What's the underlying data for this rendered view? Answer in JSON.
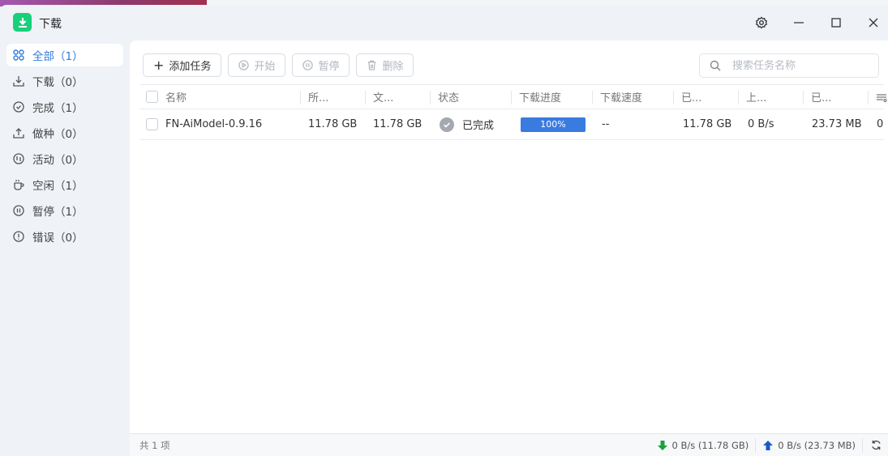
{
  "window": {
    "title": "下载",
    "settings_icon": "gear-icon",
    "minimize_icon": "minimize-icon",
    "maximize_icon": "maximize-icon",
    "close_icon": "close-icon"
  },
  "sidebar": {
    "items": [
      {
        "label": "全部（1）",
        "icon": "grid-icon",
        "active": true
      },
      {
        "label": "下载（0）",
        "icon": "download-icon"
      },
      {
        "label": "完成（1）",
        "icon": "check-circle-icon"
      },
      {
        "label": "做种（0）",
        "icon": "upload-icon"
      },
      {
        "label": "活动（0）",
        "icon": "activity-icon"
      },
      {
        "label": "空闲（1）",
        "icon": "cup-icon"
      },
      {
        "label": "暂停（1）",
        "icon": "pause-circle-icon"
      },
      {
        "label": "错误（0）",
        "icon": "error-circle-icon"
      }
    ]
  },
  "toolbar": {
    "add": "添加任务",
    "start": "开始",
    "pause": "暂停",
    "delete": "删除"
  },
  "search": {
    "placeholder": "搜索任务名称",
    "value": ""
  },
  "table": {
    "columns": [
      "名称",
      "所...",
      "文...",
      "状态",
      "下载进度",
      "下载速度",
      "已...",
      "上...",
      "已..."
    ],
    "rows": [
      {
        "name": "FN-AiModel-0.9.16",
        "size1": "11.78 GB",
        "size2": "11.78 GB",
        "status": "已完成",
        "progress": 100,
        "progress_label": "100%",
        "speed": "--",
        "downloaded": "11.78 GB",
        "upload_speed": "0 B/s",
        "uploaded": "23.73 MB",
        "extra": "0"
      }
    ]
  },
  "status": {
    "count": "共 1 项",
    "down": "0 B/s (11.78 GB)",
    "up": "0 B/s (23.73 MB)"
  },
  "colors": {
    "accent": "#2d7be0",
    "logo": "#17d07a",
    "progress": "#3a7be0",
    "down": "#1aa33a",
    "up": "#1e58c7"
  }
}
